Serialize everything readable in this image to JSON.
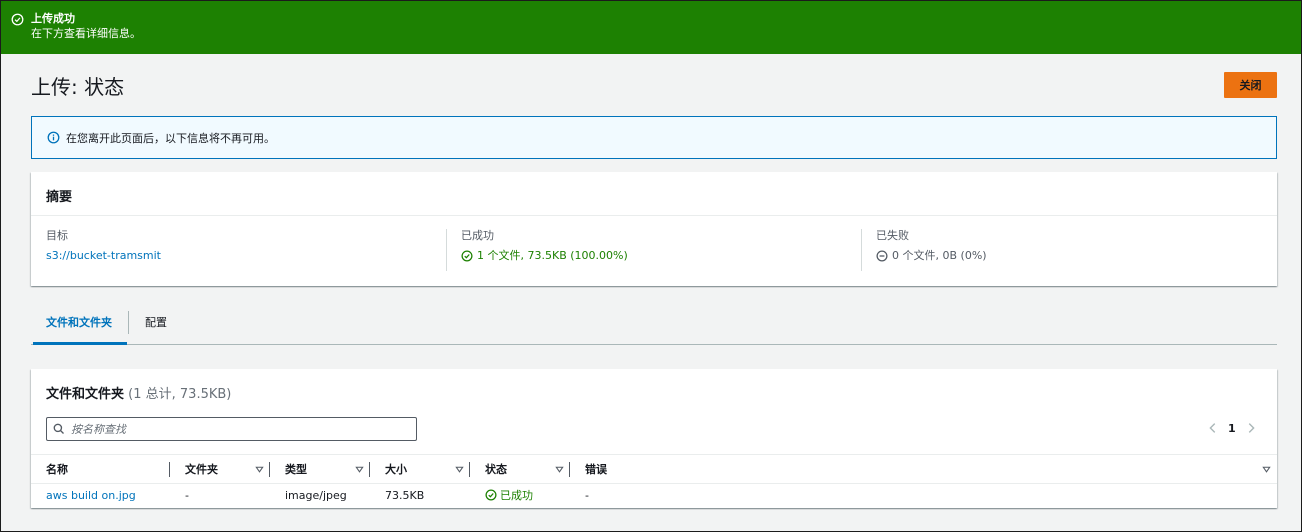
{
  "flash": {
    "title": "上传成功",
    "subtitle": "在下方查看详细信息。",
    "icon": "check-circle-icon",
    "color": "#1d8102"
  },
  "header": {
    "title": "上传: 状态",
    "close_label": "关闭",
    "close_color": "#ec7211"
  },
  "info": {
    "icon": "info-icon",
    "text": "在您离开此页面后，以下信息将不再可用。"
  },
  "summary": {
    "title": "摘要",
    "destination": {
      "label": "目标",
      "value": "s3://bucket-tramsmit"
    },
    "succeeded": {
      "label": "已成功",
      "value": "1 个文件, 73.5KB (100.00%)",
      "icon": "check-circle-icon"
    },
    "failed": {
      "label": "已失败",
      "value": "0 个文件, 0B (0%)",
      "icon": "minus-circle-icon"
    }
  },
  "tabs": [
    {
      "label": "文件和文件夹",
      "active": true
    },
    {
      "label": "配置",
      "active": false
    }
  ],
  "files": {
    "title": "文件和文件夹",
    "count": "(1 总计, 73.5KB)",
    "search_placeholder": "按名称查找",
    "page": "1",
    "columns": [
      "名称",
      "文件夹",
      "类型",
      "大小",
      "状态",
      "错误"
    ],
    "rows": [
      {
        "name": "aws build on.jpg",
        "folder": "-",
        "type": "image/jpeg",
        "size": "73.5KB",
        "status": "已成功",
        "error": "-"
      }
    ]
  }
}
